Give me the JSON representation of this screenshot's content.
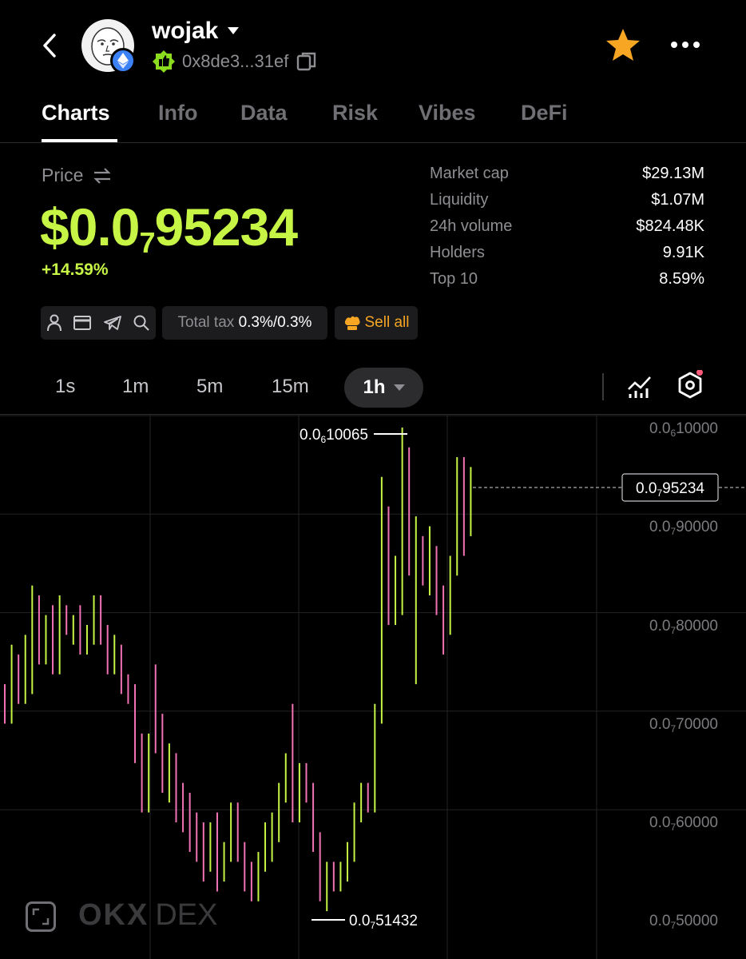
{
  "header": {
    "token_name": "wojak",
    "address": "0x8de3...31ef"
  },
  "tabs": [
    "Charts",
    "Info",
    "Data",
    "Risk",
    "Vibes",
    "DeFi"
  ],
  "active_tab": "Charts",
  "price": {
    "label": "Price",
    "display_prefix": "$0.0",
    "display_subscript": "7",
    "display_suffix": "95234",
    "change": "+14.59%"
  },
  "stats": [
    {
      "label": "Market cap",
      "value": "$29.13M"
    },
    {
      "label": "Liquidity",
      "value": "$1.07M"
    },
    {
      "label": "24h volume",
      "value": "$824.48K"
    },
    {
      "label": "Holders",
      "value": "9.91K"
    },
    {
      "label": "Top 10",
      "value": "8.59%"
    }
  ],
  "tax": {
    "label": "Total tax",
    "value": "0.3%/0.3%"
  },
  "sell_all_label": "Sell all",
  "timeframes": [
    "1s",
    "1m",
    "5m",
    "15m",
    "1h"
  ],
  "active_timeframe": "1h",
  "watermark": {
    "brand": "OKX",
    "product": "DEX"
  },
  "colors": {
    "up": "#c6f545",
    "down": "#f272b6",
    "accent": "#c6f545",
    "star": "#f6a623"
  },
  "chart_data": {
    "type": "candlestick",
    "y_axis_ticks": [
      {
        "prefix": "0.0",
        "sub": "6",
        "digits": "10000",
        "value": 1e-06
      },
      {
        "prefix": "0.0",
        "sub": "7",
        "digits": "90000",
        "value": 9e-07
      },
      {
        "prefix": "0.0",
        "sub": "7",
        "digits": "80000",
        "value": 8e-07
      },
      {
        "prefix": "0.0",
        "sub": "7",
        "digits": "70000",
        "value": 7e-07
      },
      {
        "prefix": "0.0",
        "sub": "7",
        "digits": "60000",
        "value": 6e-07
      },
      {
        "prefix": "0.0",
        "sub": "7",
        "digits": "50000",
        "value": 5e-07
      }
    ],
    "high_label": {
      "prefix": "0.0",
      "sub": "6",
      "digits": "10065",
      "value": 1.0065e-06
    },
    "low_label": {
      "prefix": "0.0",
      "sub": "7",
      "digits": "51432",
      "value": 5.1432e-07
    },
    "current_label": {
      "prefix": "0.0",
      "sub": "7",
      "digits": "95234",
      "value": 9.5234e-07
    },
    "unit_scale": "1e-8",
    "candles": [
      [
        72,
        74,
        70,
        71
      ],
      [
        71,
        78,
        70,
        76
      ],
      [
        76,
        77,
        72,
        73
      ],
      [
        73,
        79,
        72,
        74
      ],
      [
        74,
        84,
        73,
        82
      ],
      [
        82,
        83,
        76,
        77
      ],
      [
        77,
        81,
        76,
        80
      ],
      [
        80,
        82,
        75,
        76
      ],
      [
        76,
        83,
        75,
        82
      ],
      [
        82,
        82,
        79,
        80
      ],
      [
        80,
        81,
        78,
        81
      ],
      [
        81,
        82,
        77,
        78
      ],
      [
        78,
        80,
        77,
        79
      ],
      [
        79,
        83,
        78,
        82
      ],
      [
        82,
        83,
        78,
        79
      ],
      [
        79,
        80,
        75,
        76
      ],
      [
        76,
        79,
        75,
        78
      ],
      [
        78,
        78,
        73,
        74
      ],
      [
        74,
        75,
        72,
        72
      ],
      [
        72,
        74,
        66,
        67
      ],
      [
        67,
        69,
        61,
        62
      ],
      [
        62,
        69,
        61,
        68
      ],
      [
        68,
        76,
        67,
        67
      ],
      [
        67,
        71,
        63,
        64
      ],
      [
        64,
        68,
        62,
        66
      ],
      [
        66,
        67,
        60,
        62
      ],
      [
        62,
        64,
        59,
        60
      ],
      [
        60,
        63,
        57,
        58
      ],
      [
        58,
        61,
        56,
        57
      ],
      [
        57,
        60,
        54,
        56
      ],
      [
        56,
        60,
        55,
        59
      ],
      [
        59,
        61,
        53,
        55
      ],
      [
        55,
        58,
        54,
        57
      ],
      [
        57,
        62,
        56,
        60
      ],
      [
        60,
        62,
        56,
        57
      ],
      [
        57,
        58,
        53,
        54
      ],
      [
        54,
        56,
        52,
        53
      ],
      [
        53,
        57,
        52,
        56
      ],
      [
        56,
        60,
        55,
        58
      ],
      [
        58,
        61,
        56,
        59
      ],
      [
        59,
        64,
        58,
        63
      ],
      [
        63,
        67,
        62,
        66
      ],
      [
        66,
        72,
        60,
        61
      ],
      [
        61,
        66,
        60,
        65
      ],
      [
        65,
        66,
        62,
        63
      ],
      [
        63,
        64,
        57,
        58
      ],
      [
        58,
        59,
        52,
        53
      ],
      [
        53,
        56,
        51,
        55
      ],
      [
        55,
        56,
        53,
        54
      ],
      [
        54,
        56,
        53,
        55
      ],
      [
        55,
        58,
        54,
        57
      ],
      [
        57,
        62,
        56,
        61
      ],
      [
        61,
        64,
        60,
        63
      ],
      [
        63,
        64,
        61,
        62
      ],
      [
        62,
        72,
        61,
        71
      ],
      [
        71,
        95,
        70,
        91
      ],
      [
        91,
        92,
        80,
        81
      ],
      [
        81,
        87,
        80,
        82
      ],
      [
        82,
        100,
        81,
        97
      ],
      [
        97,
        98,
        85,
        86
      ],
      [
        86,
        91,
        74,
        88
      ],
      [
        88,
        89,
        84,
        85
      ],
      [
        85,
        90,
        83,
        87
      ],
      [
        87,
        88,
        81,
        82
      ],
      [
        82,
        84,
        77,
        80
      ],
      [
        80,
        87,
        79,
        86
      ],
      [
        86,
        97,
        85,
        94
      ],
      [
        94,
        97,
        87,
        90
      ],
      [
        90,
        96,
        89,
        95
      ]
    ]
  }
}
